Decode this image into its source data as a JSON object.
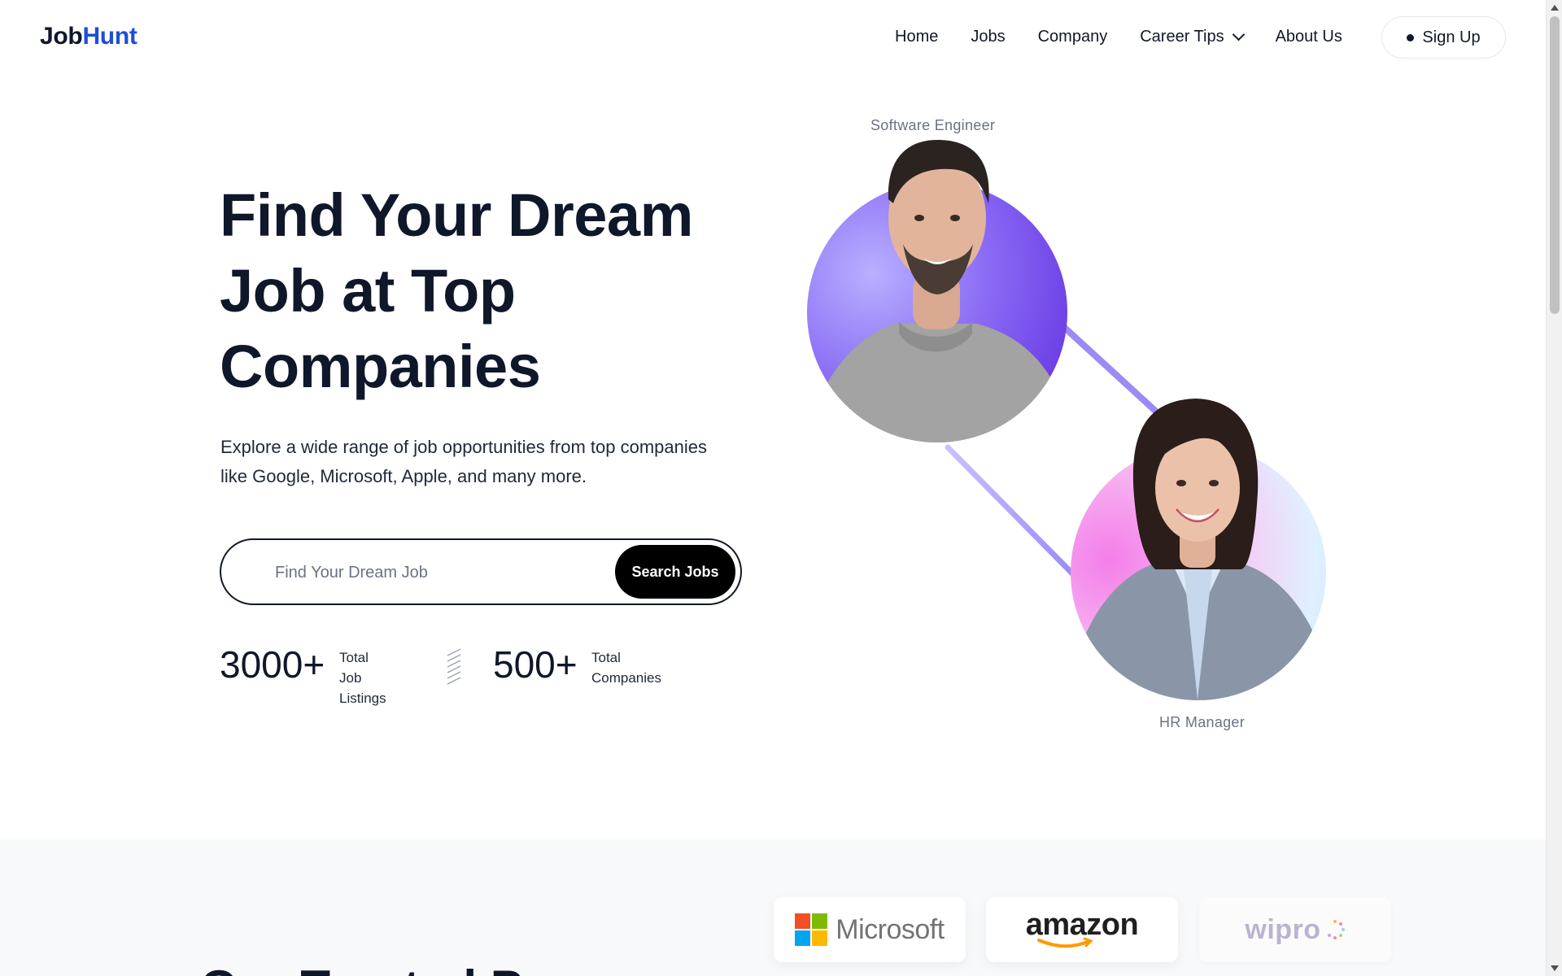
{
  "header": {
    "logo_part1": "Job",
    "logo_part2": "Hunt",
    "nav": [
      {
        "label": "Home"
      },
      {
        "label": "Jobs"
      },
      {
        "label": "Company"
      },
      {
        "label": "Career Tips"
      },
      {
        "label": "About Us"
      }
    ],
    "signup_label": "Sign Up"
  },
  "hero": {
    "title_line1": "Find Your Dream",
    "title_line2": "Job at Top",
    "title_line3": "Companies",
    "description_line1": "Explore a wide range of job opportunities from top companies",
    "description_line2": "like Google, Microsoft, Apple, and many more.",
    "search_placeholder": "Find Your Dream Job",
    "search_button": "Search Jobs",
    "stats": [
      {
        "number": "3000+",
        "label_line1": "Total",
        "label_line2": "Job Listings"
      },
      {
        "number": "500+",
        "label_line1": "Total",
        "label_line2": "Companies"
      }
    ],
    "roles": {
      "top": "Software Engineer",
      "bottom": "HR Manager"
    }
  },
  "companies": {
    "logos": [
      {
        "name": "Microsoft"
      },
      {
        "name": "amazon"
      },
      {
        "name": "wipro"
      }
    ],
    "section_heading_partial": "Our Trusted P"
  },
  "colors": {
    "brand_blue": "#1d4ed8",
    "text_dark": "#0f172a",
    "purple_circle": "#7c5cf0",
    "pink_circle": "#f9a8f0"
  }
}
